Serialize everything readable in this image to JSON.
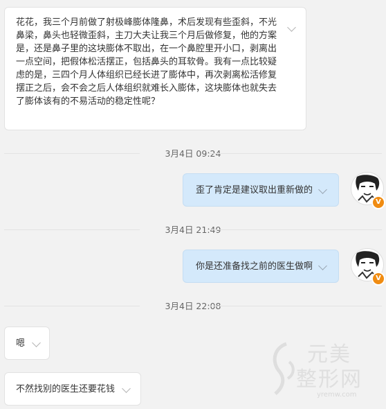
{
  "messages": [
    {
      "side": "left",
      "text": "花花，我三个月前做了射极峰膨体隆鼻，术后发现有些歪斜，不光鼻梁，鼻头也轻微歪斜，主刀大夫让我三个月后做修复，他的方案是，还是鼻子里的这块膨体不取出，在一个鼻腔里开小口，剥离出一点空间，把假体松活摆正，包括鼻头的耳软骨。我有一点比较疑虑的是，三四个月人体组织已经长进了膨体中，再次剥离松活修复摆正之后，会不会之后人体组织就难长入膨体，这块膨体也就失去了膨体该有的不易活动的稳定性呢？"
    },
    {
      "side": "right",
      "time": "3月4日 09:24",
      "text": "歪了肯定是建议取出重新做的"
    },
    {
      "side": "right",
      "time": "3月4日 21:49",
      "text": "你是还准备找之前的医生做啊"
    },
    {
      "side": "left",
      "time": "3月4日 22:08",
      "text": "嗯"
    },
    {
      "side": "left",
      "text": "不然找别的医生还要花钱"
    }
  ],
  "badge": {
    "label": "V"
  },
  "watermark": {
    "brand_line1": "元美",
    "brand_line2": "整形网",
    "url": "yremw.com"
  },
  "colors": {
    "right_bubble": "#d4e9fb",
    "left_bubble": "#ffffff",
    "badge": "#f08c12"
  }
}
